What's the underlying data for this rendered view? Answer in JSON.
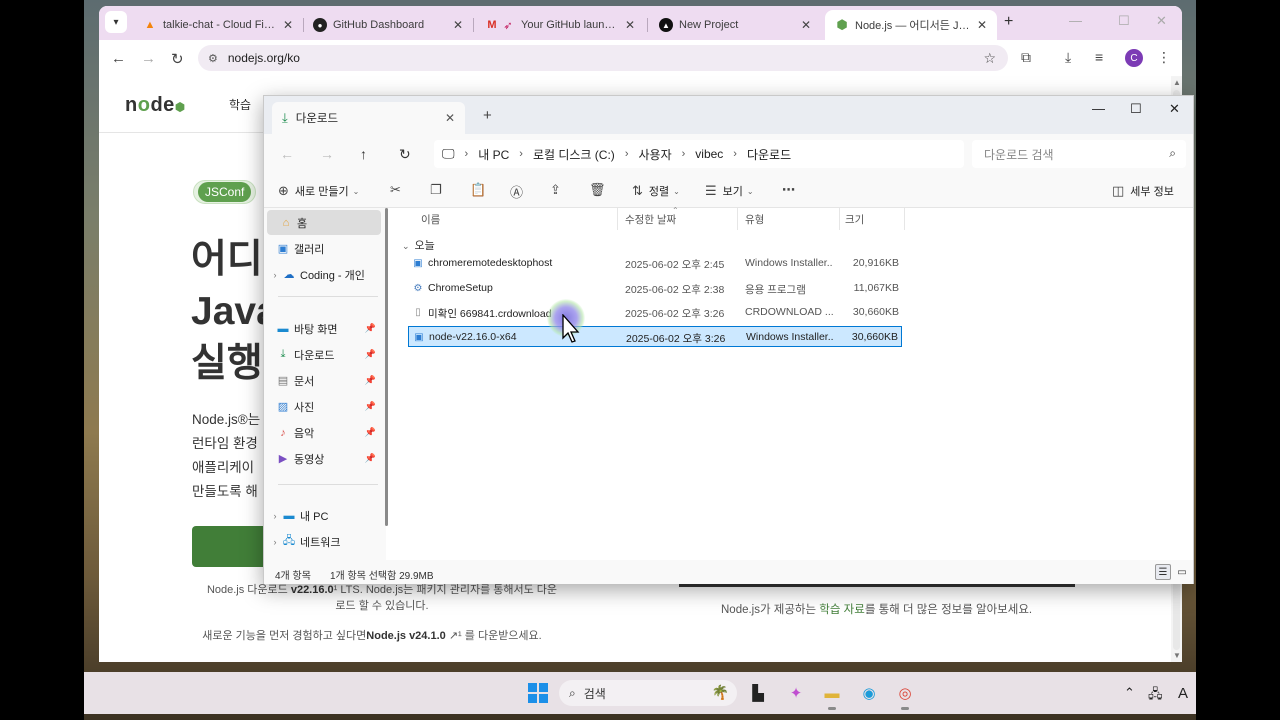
{
  "browser": {
    "tabs": [
      {
        "title": "talkie-chat - Cloud Firesto",
        "icon": "firebase-icon"
      },
      {
        "title": "GitHub Dashboard",
        "icon": "github-icon"
      },
      {
        "title": "Your GitHub launch c",
        "icon": "gmail-icon"
      },
      {
        "title": "New Project",
        "icon": "vercel-icon"
      },
      {
        "title": "Node.js — 어디서든 Java",
        "icon": "nodejs-icon",
        "active": true
      }
    ],
    "url": "nodejs.org/ko",
    "profile_initial": "C"
  },
  "webpage": {
    "logo": "node",
    "nav_learn": "학습",
    "jsconf_label": "JSConf",
    "hero_lines": [
      "어디",
      "Java",
      "실행"
    ],
    "desc_lines": [
      "Node.js®는",
      "런타임 환경",
      "애플리케이",
      "만들도록 해"
    ],
    "footnote1_pre": "Node.js 다운로드 ",
    "footnote1_version": "v22.16.0",
    "footnote1_post": "¹ LTS. Node.js는 패키지 관리자를 통해서도 다운로드 할 수 있습니다.",
    "footnote2_pre": "새로운 기능을 먼저 경험하고 싶다면",
    "footnote2_bold": "Node.js v24.1.0",
    "footnote2_post": " ↗¹ 를 다운받으세요.",
    "learn_pre": "Node.js가 제공하는 ",
    "learn_link": "학습 자료",
    "learn_post": "를 통해 더 많은 정보를 알아보세요."
  },
  "explorer": {
    "tab_title": "다운로드",
    "breadcrumb": [
      "내 PC",
      "로컬 디스크 (C:)",
      "사용자",
      "vibec",
      "다운로드"
    ],
    "search_placeholder": "다운로드 검색",
    "cmd": {
      "new": "새로 만들기",
      "sort": "정렬",
      "view": "보기",
      "details": "세부 정보"
    },
    "sidebar": [
      {
        "label": "홈",
        "icon": "home-icon",
        "selected": true
      },
      {
        "label": "갤러리",
        "icon": "gallery-icon"
      },
      {
        "label": "Coding - 개인",
        "icon": "cloud-icon",
        "expandable": true
      },
      {
        "label": "바탕 화면",
        "icon": "desktop-icon",
        "pinned": true
      },
      {
        "label": "다운로드",
        "icon": "download-icon",
        "pinned": true
      },
      {
        "label": "문서",
        "icon": "document-icon",
        "pinned": true
      },
      {
        "label": "사진",
        "icon": "pictures-icon",
        "pinned": true
      },
      {
        "label": "음악",
        "icon": "music-icon",
        "pinned": true
      },
      {
        "label": "동영상",
        "icon": "video-icon",
        "pinned": true
      },
      {
        "label": "내 PC",
        "icon": "pc-icon",
        "expandable": true
      },
      {
        "label": "네트워크",
        "icon": "network-icon",
        "expandable": true
      }
    ],
    "columns": {
      "name": "이름",
      "modified": "수정한 날짜",
      "type": "유형",
      "size": "크기"
    },
    "group": "오늘",
    "files": [
      {
        "name": "chromeremotedesktophost",
        "date": "2025-06-02 오후 2:45",
        "type": "Windows Installer...",
        "size": "20,916KB",
        "icon": "installer-icon"
      },
      {
        "name": "ChromeSetup",
        "date": "2025-06-02 오후 2:38",
        "type": "응용 프로그램",
        "size": "11,067KB",
        "icon": "setup-icon"
      },
      {
        "name": "미확인 669841.crdownload",
        "date": "2025-06-02 오후 3:26",
        "type": "CRDOWNLOAD ...",
        "size": "30,660KB",
        "icon": "file-icon"
      },
      {
        "name": "node-v22.16.0-x64",
        "date": "2025-06-02 오후 3:26",
        "type": "Windows Installer...",
        "size": "30,660KB",
        "icon": "installer-icon",
        "selected": true
      }
    ],
    "status_count": "4개 항목",
    "status_selected": "1개 항목 선택함 29.9MB"
  },
  "taskbar": {
    "search_label": "검색",
    "lang_indicator": "A"
  }
}
